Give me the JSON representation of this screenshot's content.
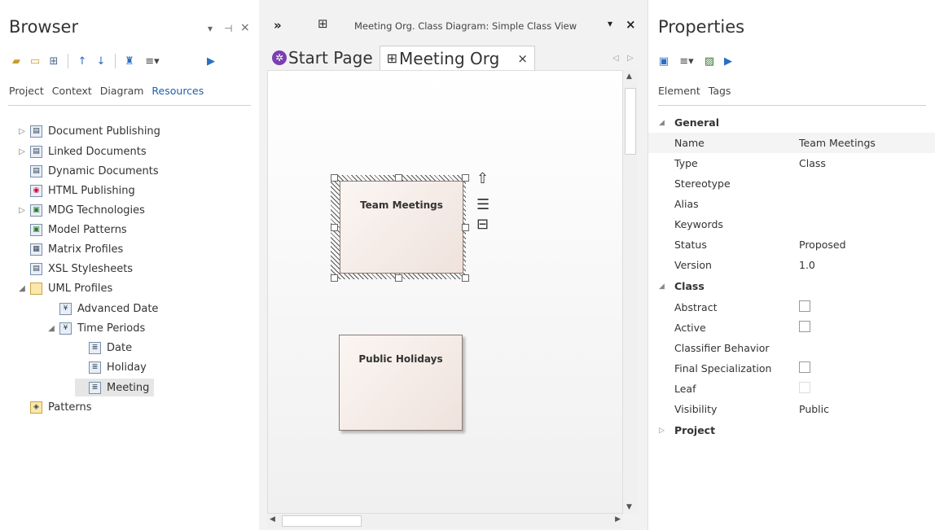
{
  "browser": {
    "title": "Browser",
    "controls": {
      "dropdown": "▾",
      "pin": "⊣",
      "close": "×"
    },
    "tabs": [
      "Project",
      "Context",
      "Diagram",
      "Resources"
    ],
    "active_tab": "Resources",
    "tree": [
      {
        "label": "Document Publishing",
        "expander": "▷",
        "depth": 0
      },
      {
        "label": "Linked Documents",
        "expander": "▷",
        "depth": 0
      },
      {
        "label": "Dynamic Documents",
        "expander": "",
        "depth": 0
      },
      {
        "label": "HTML Publishing",
        "expander": "",
        "depth": 0
      },
      {
        "label": "MDG Technologies",
        "expander": "▷",
        "depth": 0
      },
      {
        "label": "Model Patterns",
        "expander": "",
        "depth": 0
      },
      {
        "label": "Matrix Profiles",
        "expander": "",
        "depth": 0
      },
      {
        "label": "XSL Stylesheets",
        "expander": "",
        "depth": 0
      },
      {
        "label": "UML Profiles",
        "expander": "◢",
        "depth": 0
      },
      {
        "label": "Advanced Date",
        "expander": "",
        "depth": 1
      },
      {
        "label": "Time Periods",
        "expander": "◢",
        "depth": 1
      },
      {
        "label": "Date",
        "expander": "",
        "depth": 2
      },
      {
        "label": "Holiday",
        "expander": "",
        "depth": 2
      },
      {
        "label": "Meeting",
        "expander": "",
        "depth": 2
      },
      {
        "label": "Patterns",
        "expander": "",
        "depth": 0
      }
    ]
  },
  "diagram": {
    "window_title": "Meeting Org.  Class Diagram: Simple Class View",
    "tabs": [
      {
        "label": "Start Page"
      },
      {
        "label": "Meeting Org"
      }
    ],
    "classes": [
      "Team Meetings",
      "Public Holidays"
    ]
  },
  "properties": {
    "title": "Properties",
    "tabs": [
      "Element",
      "Tags"
    ],
    "sections": {
      "general": "General",
      "class": "Class",
      "project": "Project"
    },
    "general": [
      {
        "key": "Name",
        "value": "Team Meetings"
      },
      {
        "key": "Type",
        "value": "Class"
      },
      {
        "key": "Stereotype",
        "value": ""
      },
      {
        "key": "Alias",
        "value": ""
      },
      {
        "key": "Keywords",
        "value": ""
      },
      {
        "key": "Status",
        "value": "Proposed"
      },
      {
        "key": "Version",
        "value": "1.0"
      }
    ],
    "class_rows": [
      {
        "key": "Abstract",
        "value": "",
        "checkbox": true
      },
      {
        "key": "Active",
        "value": "",
        "checkbox": true
      },
      {
        "key": "Classifier Behavior",
        "value": "",
        "checkbox": false
      },
      {
        "key": "Final Specialization",
        "value": "",
        "checkbox": true
      },
      {
        "key": "Leaf",
        "value": "",
        "checkbox": true
      },
      {
        "key": "Visibility",
        "value": "Public",
        "checkbox": false
      }
    ]
  }
}
